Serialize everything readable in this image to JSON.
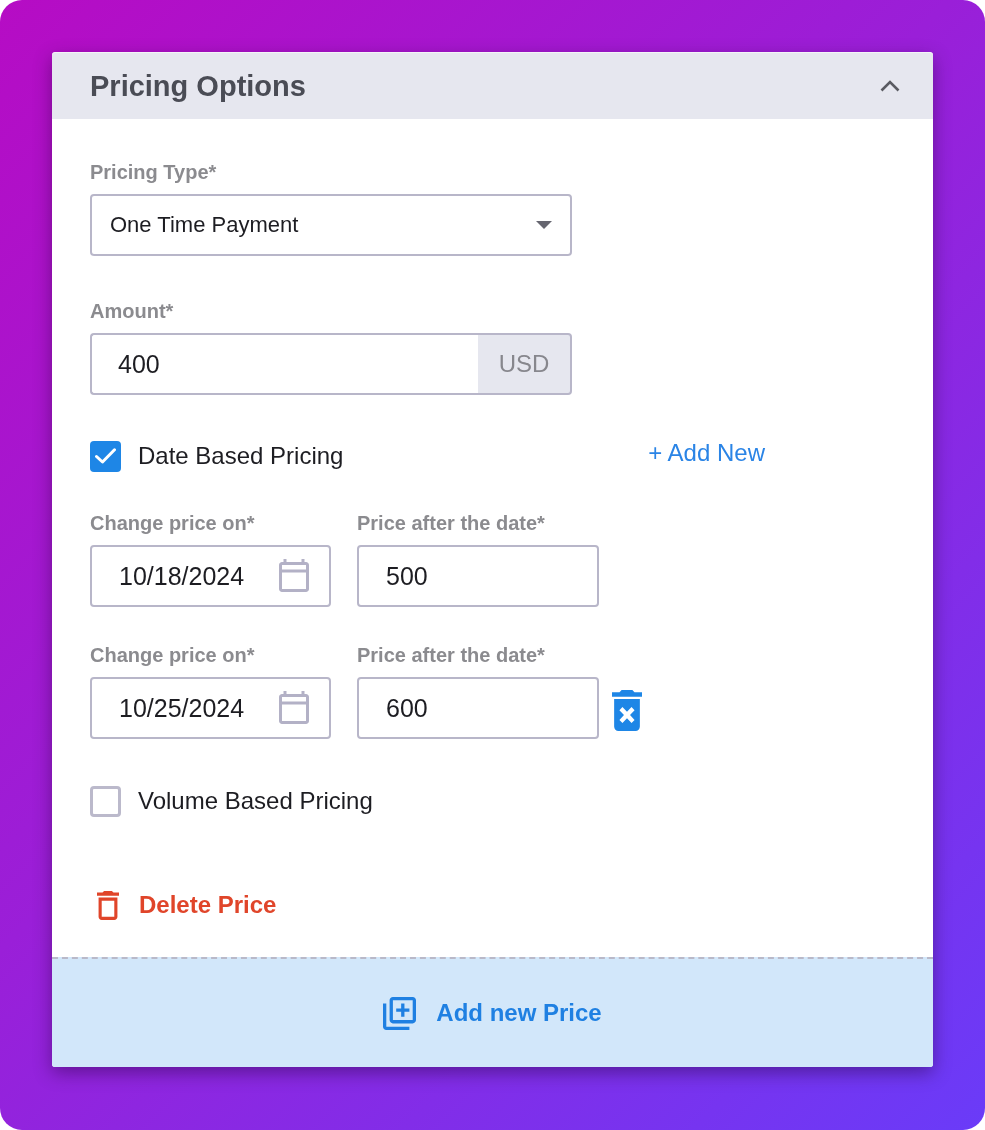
{
  "panel": {
    "title": "Pricing Options",
    "expanded": true
  },
  "pricing_type": {
    "label": "Pricing Type*",
    "value": "One Time Payment"
  },
  "amount": {
    "label": "Amount*",
    "value": "400",
    "currency": "USD"
  },
  "date_pricing": {
    "label": "Date Based Pricing",
    "checked": true,
    "add_new": "+ Add New",
    "rows": [
      {
        "date_label": "Change price on*",
        "date": "10/18/2024",
        "price_label": "Price after the date*",
        "price": "500",
        "removable": false
      },
      {
        "date_label": "Change price on*",
        "date": "10/25/2024",
        "price_label": "Price after the date*",
        "price": "600",
        "removable": true
      }
    ]
  },
  "volume_pricing": {
    "label": "Volume Based Pricing",
    "checked": false
  },
  "delete_button": "Delete Price",
  "add_button": "Add new Price"
}
